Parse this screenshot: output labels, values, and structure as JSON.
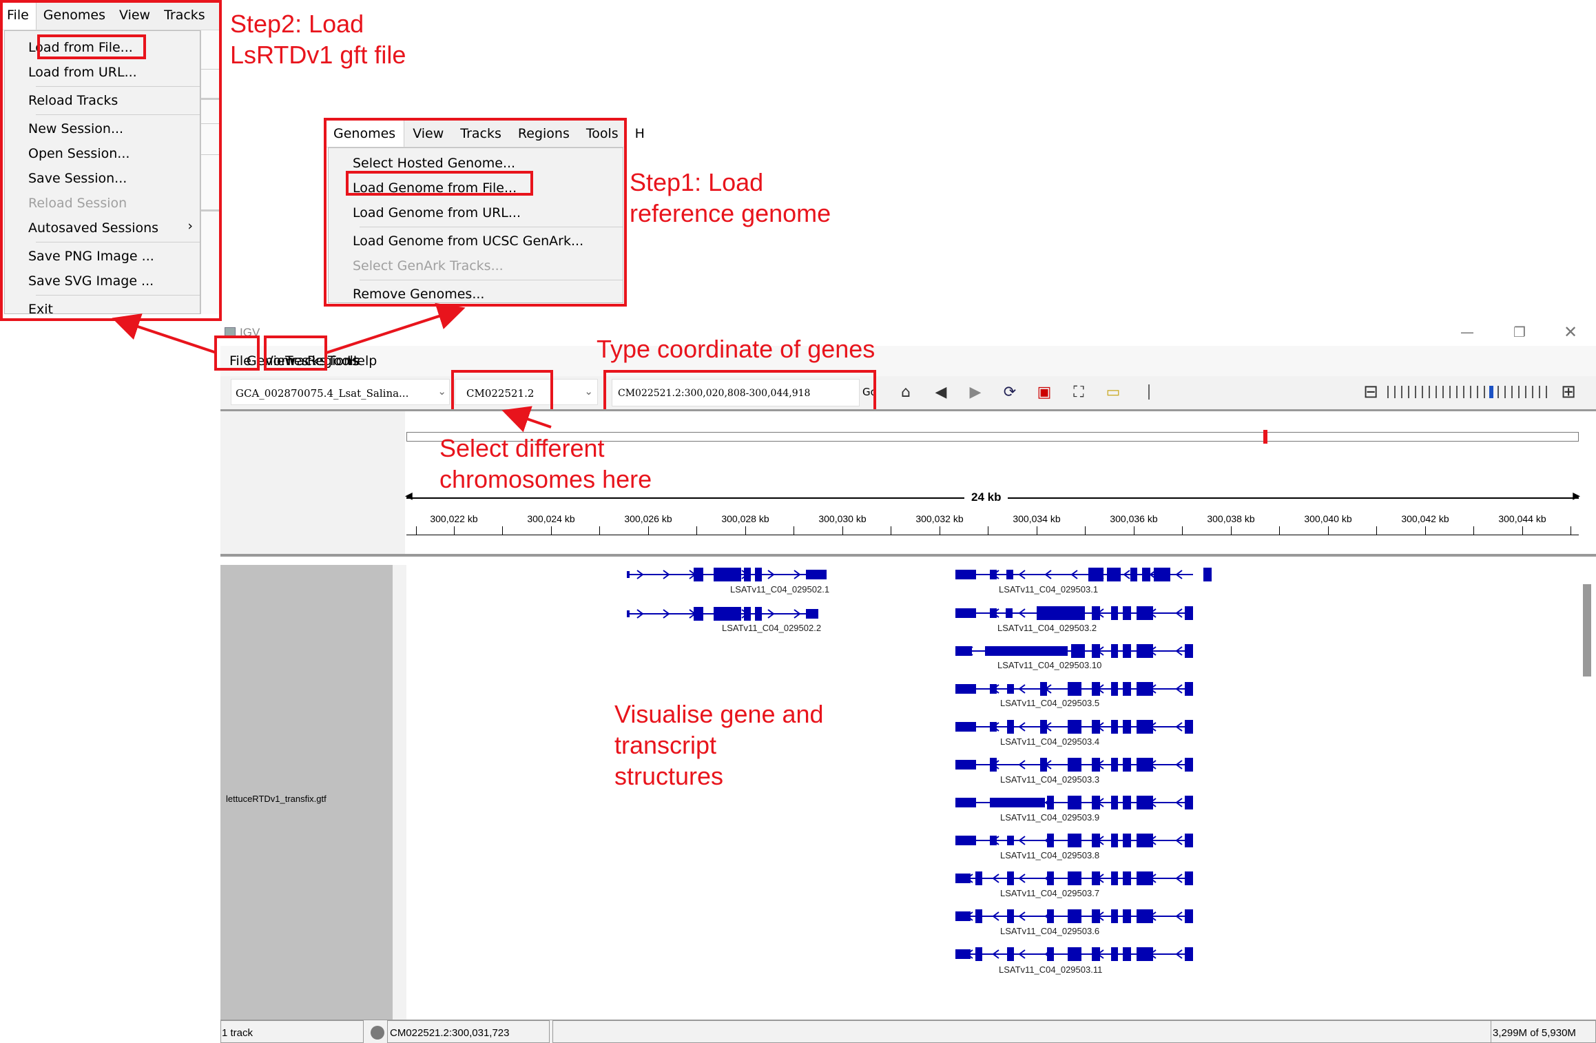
{
  "file_menu": {
    "bar": [
      "File",
      "Genomes",
      "View",
      "Tracks"
    ],
    "items": [
      {
        "label": "Load from File...",
        "disabled": false
      },
      {
        "label": "Load from URL...",
        "disabled": false
      },
      {
        "sep": true
      },
      {
        "label": "Reload Tracks",
        "disabled": false
      },
      {
        "sep": true
      },
      {
        "label": "New Session...",
        "disabled": false
      },
      {
        "label": "Open Session...",
        "disabled": false
      },
      {
        "label": "Save Session...",
        "disabled": false
      },
      {
        "label": "Reload Session",
        "disabled": true
      },
      {
        "label": "Autosaved Sessions",
        "disabled": false,
        "arrow": "›"
      },
      {
        "sep": true
      },
      {
        "label": "Save PNG Image ...",
        "disabled": false
      },
      {
        "label": "Save SVG Image ...",
        "disabled": false
      },
      {
        "sep": true
      },
      {
        "label": "Exit",
        "disabled": false
      }
    ]
  },
  "genomes_menu": {
    "bar": [
      "Genomes",
      "View",
      "Tracks",
      "Regions",
      "Tools",
      "H"
    ],
    "items": [
      {
        "label": "Select Hosted Genome...",
        "disabled": false
      },
      {
        "label": "Load Genome from File...",
        "disabled": false
      },
      {
        "label": "Load Genome from URL...",
        "disabled": false
      },
      {
        "sep": true
      },
      {
        "label": "Load Genome from UCSC GenArk...",
        "disabled": false
      },
      {
        "label": "Select GenArk Tracks...",
        "disabled": true
      },
      {
        "sep": true
      },
      {
        "label": "Remove Genomes...",
        "disabled": false
      }
    ]
  },
  "annotations": {
    "step2": "Step2: Load\nLsRTDv1 gft file",
    "step1": "Step1: Load\nreference genome",
    "coord": "Type coordinate of genes",
    "chrom": "Select different\nchromosomes here",
    "visual": "Visualise gene and\ntranscript\nstructures"
  },
  "igv": {
    "title": "IGV",
    "menus": [
      "File",
      "Genomes",
      "View",
      "Tracks",
      "Regions",
      "Tools",
      "Help"
    ],
    "genome_select": "GCA_002870075.4_Lsat_Salina...",
    "chrom_select": "CM022521.2",
    "locus": "CM022521.2:300,020,808-300,044,918",
    "go": "Go",
    "ruler_span": "24 kb",
    "ruler_ticks": [
      "300,022 kb",
      "300,024 kb",
      "300,026 kb",
      "300,028 kb",
      "300,030 kb",
      "300,032 kb",
      "300,034 kb",
      "300,036 kb",
      "300,038 kb",
      "300,040 kb",
      "300,042 kb",
      "300,044 kb"
    ],
    "track_name": "lettuceRTDv1_transfix.gtf",
    "transcripts": [
      "LSATv11_C04_029502.1",
      "LSATv11_C04_029502.2",
      "LSATv11_C04_029503.1",
      "LSATv11_C04_029503.2",
      "LSATv11_C04_029503.10",
      "LSATv11_C04_029503.5",
      "LSATv11_C04_029503.4",
      "LSATv11_C04_029503.3",
      "LSATv11_C04_029503.9",
      "LSATv11_C04_029503.8",
      "LSATv11_C04_029503.7",
      "LSATv11_C04_029503.6",
      "LSATv11_C04_029503.11"
    ],
    "status_tracks": "1 track",
    "status_pos": "CM022521.2:300,031,723",
    "status_mem": "3,299M of 5,930M"
  },
  "colors": {
    "accent_red": "#e8141c",
    "feature_blue": "#0000b2"
  }
}
